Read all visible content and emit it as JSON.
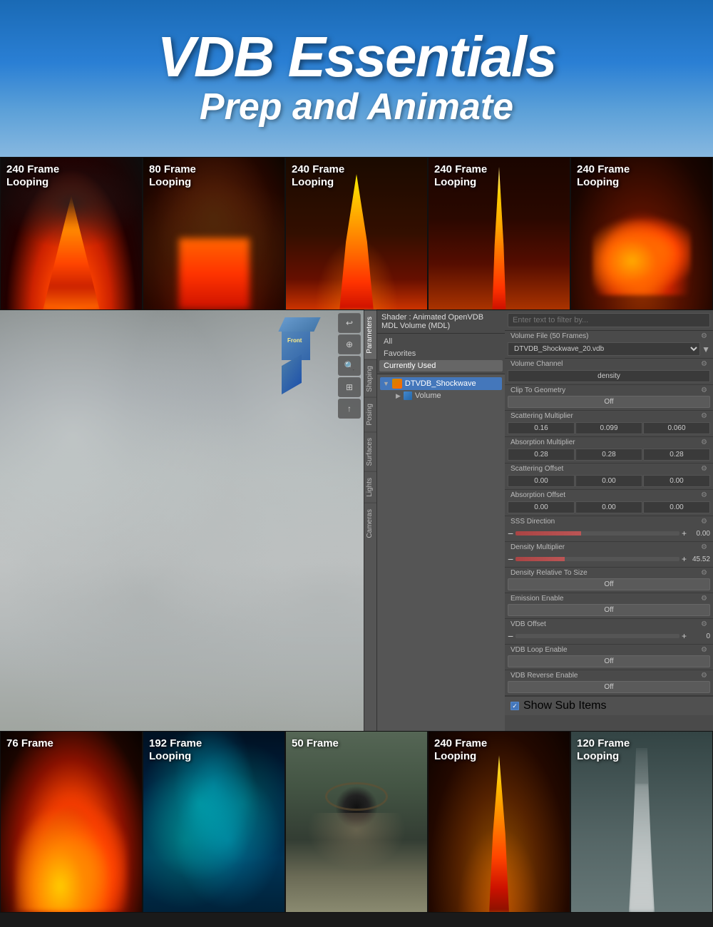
{
  "header": {
    "title_main": "VDB Essentials",
    "title_sub": "Prep and Animate"
  },
  "top_thumbnails": [
    {
      "frame_count": "240 Frame",
      "loop_label": "Looping",
      "index": 1
    },
    {
      "frame_count": "80 Frame",
      "loop_label": "Looping",
      "index": 2
    },
    {
      "frame_count": "240 Frame",
      "loop_label": "Looping",
      "index": 3
    },
    {
      "frame_count": "240 Frame",
      "loop_label": "Looping",
      "index": 4
    },
    {
      "frame_count": "240 Frame",
      "loop_label": "Looping",
      "index": 5
    }
  ],
  "shader_label": "Shader :  Animated OpenVDB MDL Volume (MDL)",
  "material_filters": {
    "all": "All",
    "favorites": "Favorites",
    "currently_used": "Currently Used"
  },
  "material_tree": {
    "root": "DTVDB_Shockwave",
    "child": "Volume"
  },
  "properties": {
    "search_placeholder": "Enter text to filter by...",
    "volume_file_label": "Volume File (50 Frames)",
    "volume_file_value": "DTVDB_Shockwave_20.vdb",
    "volume_channel_label": "Volume Channel",
    "volume_channel_value": "density",
    "clip_geo_label": "Clip To Geometry",
    "clip_geo_value": "Off",
    "scattering_label": "Scattering Multiplier",
    "scattering_r": "0.16",
    "scattering_g": "0.099",
    "scattering_b": "0.060",
    "absorption_label": "Absorption Multiplier",
    "absorption_r": "0.28",
    "absorption_g": "0.28",
    "absorption_b": "0.28",
    "scattering_offset_label": "Scattering Offset",
    "scattering_off_r": "0.00",
    "scattering_off_g": "0.00",
    "scattering_off_b": "0.00",
    "absorption_offset_label": "Absorption Offset",
    "absorption_off_r": "0.00",
    "absorption_off_g": "0.00",
    "absorption_off_b": "0.00",
    "sss_label": "SSS Direction",
    "sss_value": "0.00",
    "density_mult_label": "Density Multiplier",
    "density_mult_value": "45.52",
    "density_rel_label": "Density Relative To Size",
    "density_rel_value": "Off",
    "emission_label": "Emission Enable",
    "emission_value": "Off",
    "vdb_offset_label": "VDB Offset",
    "vdb_offset_value": "0",
    "vdb_loop_label": "VDB Loop Enable",
    "vdb_loop_value": "Off",
    "vdb_reverse_label": "VDB Reverse Enable",
    "vdb_reverse_value": "Off",
    "show_sub": "Show Sub Items"
  },
  "panel_tabs": [
    "Parameters",
    "Shaping",
    "Posing",
    "Surfaces",
    "Lights",
    "Cameras"
  ],
  "viewport_buttons": [
    "↩",
    "⊕",
    "🔍",
    "⊡",
    "↑"
  ],
  "bottom_thumbnails": [
    {
      "frame_count": "76 Frame",
      "loop_label": "",
      "index": 1
    },
    {
      "frame_count": "192 Frame",
      "loop_label": "Looping",
      "index": 2
    },
    {
      "frame_count": "50 Frame",
      "loop_label": "",
      "index": 3
    },
    {
      "frame_count": "240 Frame",
      "loop_label": "Looping",
      "index": 4
    },
    {
      "frame_count": "120 Frame",
      "loop_label": "Looping",
      "index": 5
    }
  ]
}
